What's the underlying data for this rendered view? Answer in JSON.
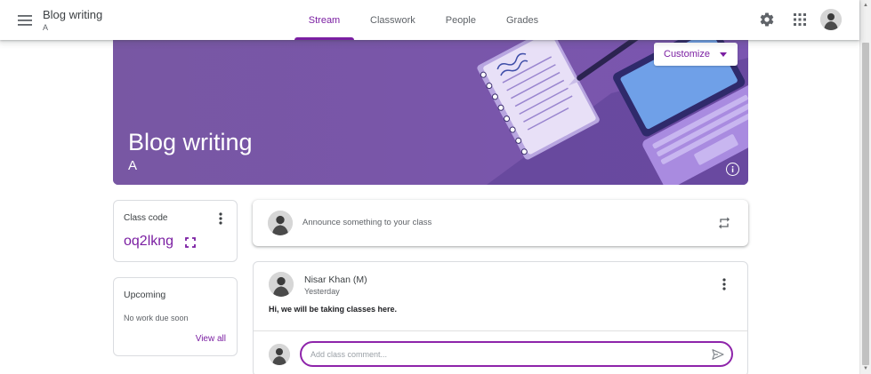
{
  "header": {
    "class_title": "Blog writing",
    "class_section": "A",
    "tabs": [
      {
        "label": "Stream",
        "active": true
      },
      {
        "label": "Classwork",
        "active": false
      },
      {
        "label": "People",
        "active": false
      },
      {
        "label": "Grades",
        "active": false
      }
    ],
    "icons": [
      "menu-icon",
      "gear-icon",
      "apps-grid-icon",
      "avatar"
    ]
  },
  "banner": {
    "title": "Blog writing",
    "section": "A",
    "customize_label": "Customize",
    "background_color": "#7b5aa6"
  },
  "class_code": {
    "label": "Class code",
    "value": "oq2lkng"
  },
  "upcoming": {
    "title": "Upcoming",
    "empty_text": "No work due soon",
    "view_all_label": "View all"
  },
  "announce": {
    "placeholder": "Announce something to your class"
  },
  "post": {
    "author": "Nisar Khan (M)",
    "date": "Yesterday",
    "body": "Hi, we will be taking classes here.",
    "comment_placeholder": "Add class comment..."
  },
  "colors": {
    "accent": "#7b1fa2",
    "banner": "#7b5aa6"
  }
}
